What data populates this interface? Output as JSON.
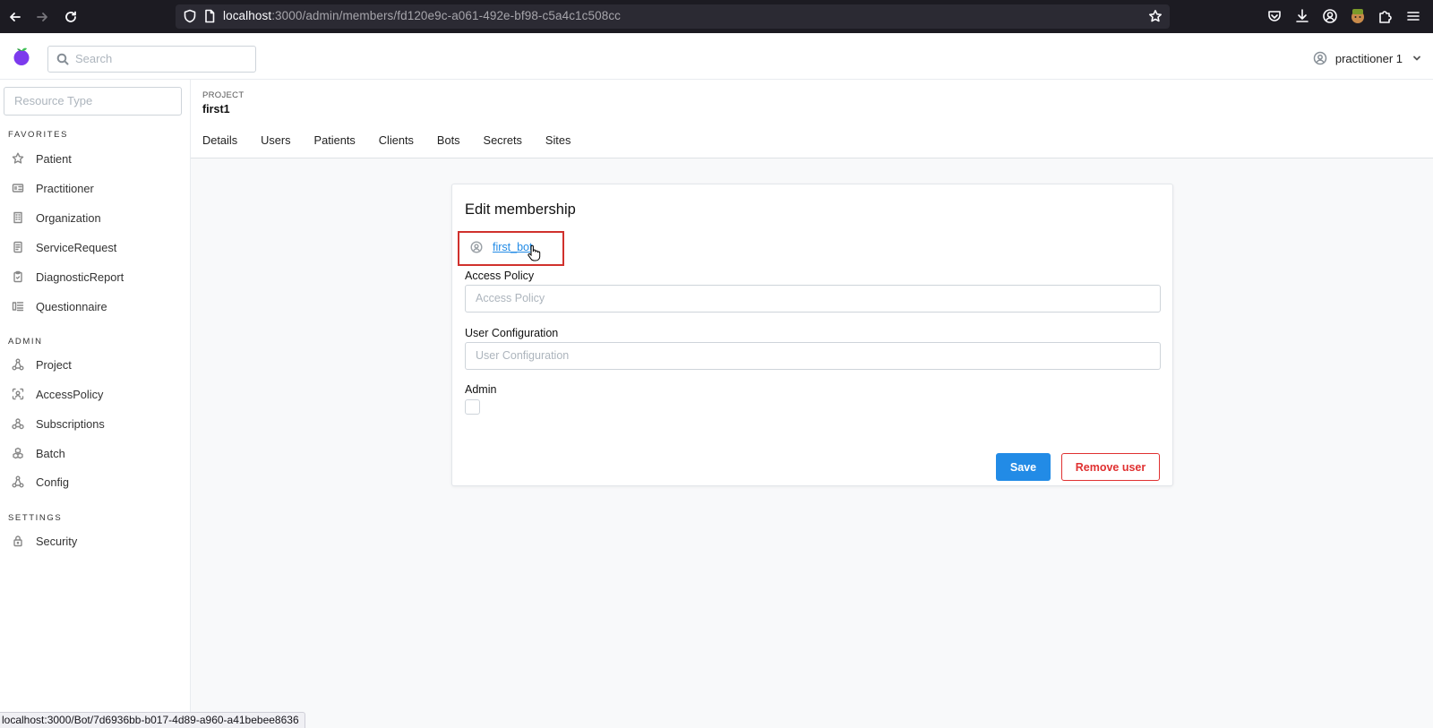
{
  "browser": {
    "url_host": "localhost",
    "url_rest": ":3000/admin/members/fd120e9c-a061-492e-bf98-c5a4c1c508cc"
  },
  "header": {
    "search_placeholder": "Search",
    "user_name": "practitioner 1"
  },
  "sidebar": {
    "resource_type_placeholder": "Resource Type",
    "favorites_label": "FAVORITES",
    "favorites": [
      {
        "label": "Patient",
        "icon": "star-icon"
      },
      {
        "label": "Practitioner",
        "icon": "id-card-icon"
      },
      {
        "label": "Organization",
        "icon": "building-icon"
      },
      {
        "label": "ServiceRequest",
        "icon": "report-icon"
      },
      {
        "label": "DiagnosticReport",
        "icon": "clipboard-icon"
      },
      {
        "label": "Questionnaire",
        "icon": "checklist-icon"
      }
    ],
    "admin_label": "ADMIN",
    "admin": [
      {
        "label": "Project",
        "icon": "hierarchy-icon"
      },
      {
        "label": "AccessPolicy",
        "icon": "face-scan-icon"
      },
      {
        "label": "Subscriptions",
        "icon": "webhook-icon"
      },
      {
        "label": "Batch",
        "icon": "packages-icon"
      },
      {
        "label": "Config",
        "icon": "hierarchy-icon"
      }
    ],
    "settings_label": "SETTINGS",
    "settings": [
      {
        "label": "Security",
        "icon": "lock-icon"
      }
    ]
  },
  "project": {
    "label": "PROJECT",
    "name": "first1",
    "tabs": [
      "Details",
      "Users",
      "Patients",
      "Clients",
      "Bots",
      "Secrets",
      "Sites"
    ]
  },
  "card": {
    "title": "Edit membership",
    "member_name": "first_bot",
    "access_policy_label": "Access Policy",
    "access_policy_placeholder": "Access Policy",
    "user_config_label": "User Configuration",
    "user_config_placeholder": "User Configuration",
    "admin_label": "Admin",
    "save_label": "Save",
    "remove_label": "Remove user"
  },
  "status_bar": {
    "text": "localhost:3000/Bot/7d6936bb-b017-4d89-a960-a41bebee8636"
  },
  "colors": {
    "primary": "#228be6",
    "danger": "#e03131",
    "highlight_box": "#d0312d",
    "browser_chrome": "#1c1b22"
  }
}
